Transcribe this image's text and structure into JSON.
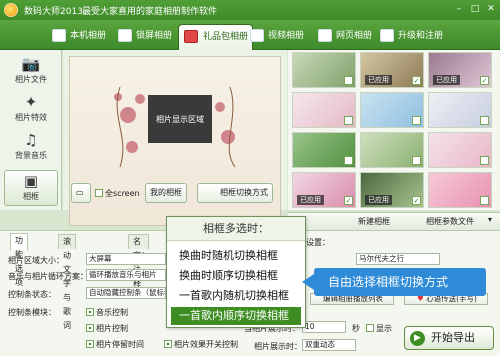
{
  "app": {
    "title": "数码大师2013",
    "slogan": "最受大家喜用的家庭相册制作软件"
  },
  "toolbar": {
    "tabs": [
      "本机相册",
      "锁屏相册",
      "礼品包相册",
      "视频相册",
      "网页相册",
      "升级和注册"
    ],
    "active_index": 2
  },
  "leftnav": {
    "items": [
      "相片文件",
      "相片特效",
      "背景音乐",
      "相框"
    ],
    "selected_index": 3
  },
  "preview": {
    "photo_area_label": "相片显示区域",
    "fullscreen_label": "全screen",
    "my_frames_button": "我的相框",
    "switch_button": "相框切换方式"
  },
  "thumbs": {
    "used_label": "已应用"
  },
  "strip": {
    "new_frame": "新建相框",
    "frame_params": "相框参数文件"
  },
  "settings": {
    "tabs": [
      "功能选项",
      "滚动文字与歌词",
      "名字/注释"
    ],
    "area_size_label": "相片区域大小：",
    "area_size_value": "大屏幕",
    "loop_label": "音乐与相片循环方案：",
    "loop_value": "循环播放音乐与相片",
    "control_label": "控制条状态：",
    "control_value": "自动隐藏控制条（鼠标移至",
    "module_label": "控制条模块：",
    "checkboxes": [
      "音乐控制",
      "相片控制",
      "相片停留时间",
      "相片效果开关控制"
    ],
    "stay_time_label": "当相片展示时：",
    "stay_time_value": "10",
    "stay_unit": "秒",
    "show_label": "显示",
    "effect_label": "相片展示时：",
    "effect_value": "双重动态",
    "right_label": "设置：",
    "right_value": "马尔代夫之行",
    "playlist_button": "编辑相册播放列表",
    "heart_button": "心语传送(手写)",
    "export_button": "开始导出"
  },
  "popup": {
    "header": "相框多选时：",
    "items": [
      "换曲时随机切换相框",
      "换曲时顺序切换相框",
      "一首歌内随机切换相框",
      "一首歌内顺序切换相框"
    ],
    "highlight_index": 3
  },
  "callout": {
    "text": "自由选择相框切换方式"
  },
  "colors": {
    "brand_green": "#3e8a28",
    "highlight": "#3d8d22",
    "callout": "#2f8bd8"
  }
}
